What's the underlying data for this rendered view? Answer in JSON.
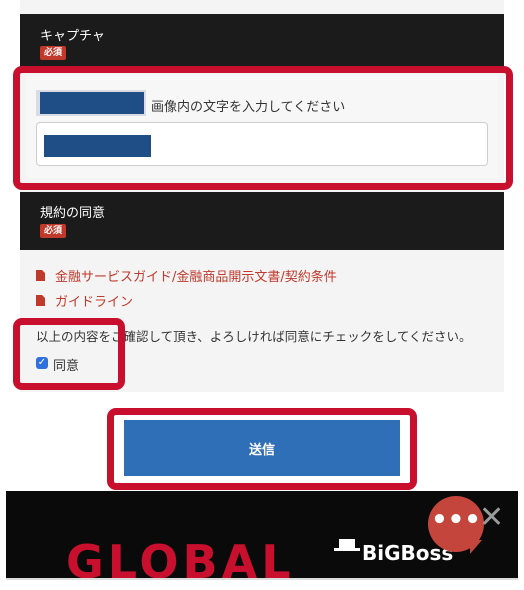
{
  "captcha": {
    "label": "キャプチャ",
    "required_badge": "必須",
    "hint": "画像内の文字を入力してください",
    "input_value": ""
  },
  "terms": {
    "label": "規約の同意",
    "required_badge": "必須",
    "links": [
      {
        "text": "金融サービスガイド/金融商品開示文書/契約条件"
      },
      {
        "text": "ガイドライン"
      }
    ],
    "confirm_text": "以上の内容をご確認して頂き、よろしければ同意にチェックをしてください。",
    "agree_label": "同意",
    "agree_checked": true
  },
  "submit": {
    "label": "送信"
  },
  "banner": {
    "left_text": "GLOBAL",
    "brand_text": "BiGBoss"
  },
  "chat": {
    "icon": "chat-bubble-icon",
    "dots": "•••",
    "close": "✕"
  },
  "colors": {
    "accent_red": "#c8102e",
    "submit_blue": "#2f6fb8",
    "link_red": "#c0392b",
    "dark_section": "#1b1b1b"
  }
}
